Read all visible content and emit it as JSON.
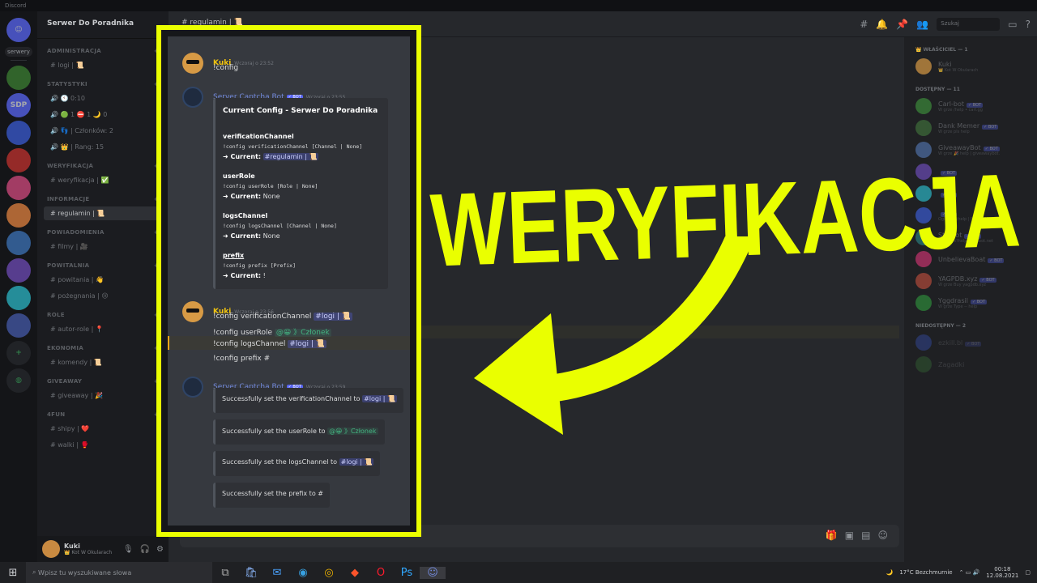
{
  "titlebar": {
    "text": "Discord"
  },
  "guilds": {
    "label": "serwery",
    "sdp": "SDP",
    "items": [
      "#3b7f32",
      "#3a5bd1",
      "#c0322d",
      "#d14a7e",
      "#e0813f",
      "#3c73b7",
      "#6d4bb6",
      "#2bb5c4",
      "#445aa8"
    ]
  },
  "server": {
    "name": "Serwer Do Poradnika"
  },
  "categories": [
    {
      "name": "ADMINISTRACJA",
      "channels": [
        "# logi | 📜"
      ]
    },
    {
      "name": "STATYSTYKI",
      "channels": [
        "🔊 🕙 0:10",
        "🔊 🟢 1 ⛔ 1 🌙 0",
        "🔊 👣 | Członków: 2",
        "🔊 👑 | Rang: 15"
      ]
    },
    {
      "name": "WERYFIKACJA",
      "channels": [
        "# weryfikacja | ✅"
      ]
    },
    {
      "name": "INFORMACJE",
      "channels": [
        "# regulamin | 📜"
      ]
    },
    {
      "name": "POWIADOMIENIA",
      "channels": [
        "# filmy | 🎥"
      ]
    },
    {
      "name": "POWITALNIA",
      "channels": [
        "# powitania | 👋",
        "# pożegnania | 😢"
      ]
    },
    {
      "name": "ROLE",
      "channels": [
        "# autor-role | 📍"
      ]
    },
    {
      "name": "EKONOMIA",
      "channels": [
        "# komendy | 📜"
      ]
    },
    {
      "name": "GIVEAWAY",
      "channels": [
        "# giveaway | 🎉"
      ]
    },
    {
      "name": "4FUN",
      "channels": [
        "# shipy | ❤️",
        "# walki | 🥊"
      ]
    }
  ],
  "user": {
    "name": "Kuki",
    "status": "👑 Kot W Okularach"
  },
  "topbar": {
    "channel": "# regulamin | 📜",
    "search_placeholder": "Szukaj"
  },
  "members": {
    "owner_cat": "👑 WŁAŚCICIEL — 1",
    "owner": {
      "name": "Kuki",
      "sub": "👑 Kot W Okularach",
      "color": "#d79a45"
    },
    "online_cat": "DOSTĘPNY — 11",
    "online": [
      {
        "name": "Carl-bot",
        "sub": "W grze /help • carl.gg",
        "color": "#3c8a3a"
      },
      {
        "name": "Dank Memer",
        "sub": "W grze pls help",
        "color": "#3e6d3a"
      },
      {
        "name": "GiveawayBot",
        "sub": "W grze 🎉 help | giveawaybot.",
        "color": "#4f6fa5"
      },
      {
        "name": "",
        "sub": "",
        "color": "#6b4bb6"
      },
      {
        "name": "",
        "sub": "",
        "color": "#2bb5c4"
      },
      {
        "name": "",
        "sub": "Ogląda @help | MMO (7E)",
        "color": "#3b5bd1"
      },
      {
        "name": "Statbot",
        "sub": "Ogląda s?help | statbot.net",
        "color": "#2a7a7a"
      },
      {
        "name": "UnbelievaBoat",
        "sub": "",
        "color": "#c5336e"
      },
      {
        "name": "YAGPDB.xyz",
        "sub": "W grze Buy yagpdb.xyz",
        "color": "#b14a3a"
      },
      {
        "name": "Yggdrasil",
        "sub": "W grze Type -- help",
        "color": "#2e8a3a"
      }
    ],
    "offline_cat": "NIEDOSTĘPNY — 2",
    "offline": [
      {
        "name": "ezkill.bl",
        "color": "#3b5bd1"
      },
      {
        "name": "Zagadki",
        "color": "#3a7a3a"
      }
    ]
  },
  "chat": {
    "m1": {
      "user": "Kuki",
      "time": "Wczoraj o 23:52",
      "text": "!config"
    },
    "m2": {
      "user": "Server Captcha Bot",
      "badge": "✓ BOT",
      "time": "Wczoraj o 23:55",
      "embed": {
        "title": "Current Config - Serwer Do Poradnika",
        "f1": {
          "name": "verificationChannel",
          "cmd": "!config verificationChannel [Channel | None]",
          "cur_label": "➜ Current:",
          "cur": "#regulamin | 📜"
        },
        "f2": {
          "name": "userRole",
          "cmd": "!config userRole [Role | None]",
          "cur_label": "➜ Current:",
          "cur": "None"
        },
        "f3": {
          "name": "logsChannel",
          "cmd": "!config logsChannel [Channel | None]",
          "cur_label": "➜ Current:",
          "cur": "None"
        },
        "f4": {
          "name": "prefix",
          "cmd": "!config prefix [Prefix]",
          "cur_label": "➜ Current:",
          "cur": "!"
        }
      }
    },
    "m3": {
      "user": "Kuki",
      "time": "Wczoraj o 23:56",
      "l1a": "!config verificationChannel",
      "l1b": "#logi | 📜",
      "l2a": "!config userRole",
      "l2b": "@😀 》Członek",
      "l3a": "!config logsChannel",
      "l3b": "#logi | 📜",
      "l4": "!config prefix #"
    },
    "m4": {
      "user": "Server Captcha Bot",
      "badge": "✓ BOT",
      "time": "Wczoraj o 23:59",
      "e1a": "Successfully set the verificationChannel to",
      "e1b": "#logi | 📜",
      "e2a": "Successfully set the userRole to",
      "e2b": "@😀 》Członek",
      "e3a": "Successfully set the logsChannel to",
      "e3b": "#logi | 📜",
      "e4": "Successfully set the prefix to #"
    }
  },
  "overlay": {
    "word": "WERYFIKACJA",
    "color": "#eaff00"
  },
  "taskbar": {
    "search": "Wpisz tu wyszukiwane słowa",
    "weather": "17°C  Bezchmurnie",
    "time": "00:18",
    "date": "12.08.2021"
  }
}
